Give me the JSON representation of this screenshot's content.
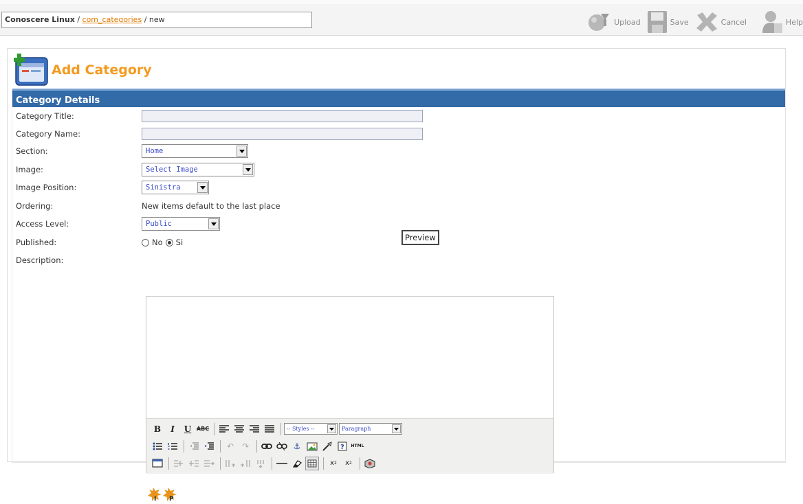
{
  "breadcrumb": {
    "site": "Conoscere Linux",
    "sep1": "/",
    "component": "com_categories",
    "sep2": "/",
    "task": "new"
  },
  "toolbar": {
    "upload": "Upload",
    "save": "Save",
    "cancel": "Cancel",
    "help": "Help"
  },
  "page": {
    "title": "Add Category"
  },
  "panel": {
    "header": "Category Details"
  },
  "fields": {
    "category_title": {
      "label": "Category Title:",
      "value": ""
    },
    "category_name": {
      "label": "Category Name:",
      "value": ""
    },
    "section": {
      "label": "Section:",
      "value": "Home"
    },
    "image": {
      "label": "Image:",
      "value": "Select Image"
    },
    "image_position": {
      "label": "Image Position:",
      "value": "Sinistra"
    },
    "ordering": {
      "label": "Ordering:",
      "value": "New items default to the last place"
    },
    "access_level": {
      "label": "Access Level:",
      "value": "Public"
    },
    "published": {
      "label": "Published:",
      "options": [
        "No",
        "Si"
      ],
      "selected": "Si"
    },
    "description": {
      "label": "Description:"
    }
  },
  "preview_button": "Preview",
  "editor": {
    "styles_select": "-- Styles --",
    "format_select": "Paragraph",
    "html_label": "HTML"
  },
  "colors": {
    "accent": "#f39a1f",
    "header": "#336aa8",
    "link": "#e07b00"
  }
}
